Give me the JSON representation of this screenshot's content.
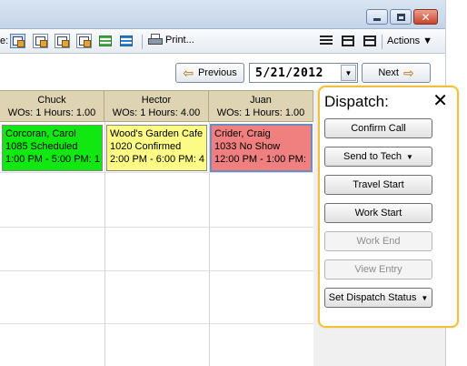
{
  "toolbar": {
    "view_label_fragment": "e:",
    "print_label": "Print...",
    "actions_label": "Actions ▼"
  },
  "nav": {
    "previous_label": "Previous",
    "date_value": "5/21/2012",
    "next_label": "Next"
  },
  "columns": [
    {
      "name": "Chuck",
      "summary": "WOs: 1 Hours: 1.00"
    },
    {
      "name": "Hector",
      "summary": "WOs: 1 Hours: 4.00"
    },
    {
      "name": "Juan",
      "summary": "WOs: 1 Hours: 1.00"
    }
  ],
  "appointments": [
    {
      "line1": "Corcoran, Carol",
      "line2": "1085 Scheduled",
      "line3": "1:00 PM - 5:00 PM: 1",
      "color": "#11e811"
    },
    {
      "line1": "Wood's Garden Cafe",
      "line2": "1020 Confirmed",
      "line3": "2:00 PM - 6:00 PM: 4",
      "color": "#fbfb86"
    },
    {
      "line1": "Crider, Craig",
      "line2": "1033 No Show",
      "line3": "12:00 PM - 1:00 PM:",
      "color": "#f08080"
    }
  ],
  "dispatch": {
    "title": "Dispatch:",
    "close_glyph": "✕",
    "buttons": [
      {
        "label": "Confirm Call",
        "enabled": true
      },
      {
        "label": "Send to Tech",
        "enabled": true,
        "dropdown": true
      },
      {
        "label": "Travel Start",
        "enabled": true
      },
      {
        "label": "Work Start",
        "enabled": true
      },
      {
        "label": "Work End",
        "enabled": false
      },
      {
        "label": "View Entry",
        "enabled": false
      },
      {
        "label": "Set Dispatch Status",
        "enabled": true,
        "dropdown": true
      }
    ]
  }
}
